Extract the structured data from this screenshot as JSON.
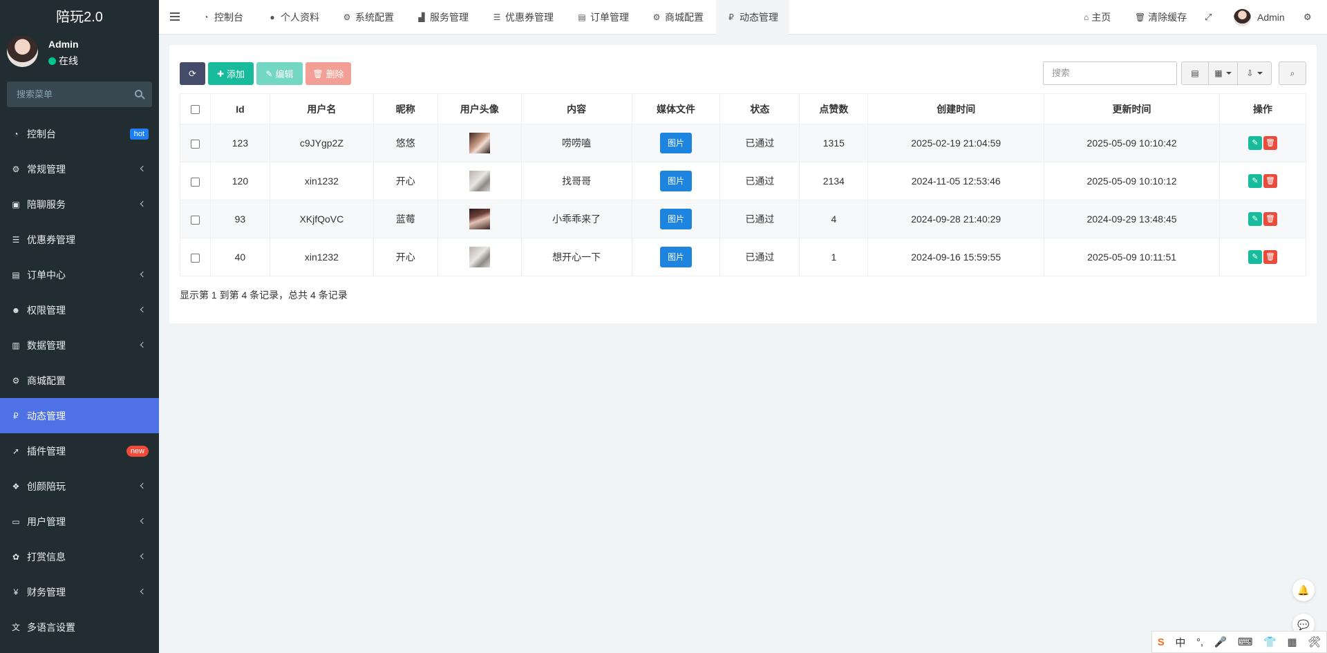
{
  "app": {
    "title": "陪玩2.0"
  },
  "user": {
    "name": "Admin",
    "status": "在线"
  },
  "sidebar": {
    "search_placeholder": "搜索菜单",
    "items": [
      {
        "label": "控制台",
        "icon": "dashboard-icon",
        "badge": "hot"
      },
      {
        "label": "常规管理",
        "icon": "cogs-icon",
        "has_children": true
      },
      {
        "label": "陪聊服务",
        "icon": "box-icon",
        "has_children": true
      },
      {
        "label": "优惠券管理",
        "icon": "list-icon"
      },
      {
        "label": "订单中心",
        "icon": "file-icon",
        "has_children": true
      },
      {
        "label": "权限管理",
        "icon": "group-icon",
        "has_children": true
      },
      {
        "label": "数据管理",
        "icon": "bar-chart-icon",
        "has_children": true
      },
      {
        "label": "商城配置",
        "icon": "cogs-icon"
      },
      {
        "label": "动态管理",
        "icon": "ruble-icon",
        "active": true
      },
      {
        "label": "插件管理",
        "icon": "rocket-icon",
        "badge": "new"
      },
      {
        "label": "创颜陪玩",
        "icon": "dropbox-icon",
        "has_children": true
      },
      {
        "label": "用户管理",
        "icon": "id-card-icon",
        "has_children": true
      },
      {
        "label": "打赏信息",
        "icon": "gift-icon",
        "has_children": true
      },
      {
        "label": "财务管理",
        "icon": "yen-icon",
        "has_children": true
      },
      {
        "label": "多语言设置",
        "icon": "language-icon"
      }
    ]
  },
  "navbar": {
    "tabs": [
      {
        "label": "控制台",
        "icon": "dashboard-icon"
      },
      {
        "label": "个人资料",
        "icon": "user-icon"
      },
      {
        "label": "系统配置",
        "icon": "gear-icon"
      },
      {
        "label": "服务管理",
        "icon": "shopping-bag-icon"
      },
      {
        "label": "优惠券管理",
        "icon": "list-icon"
      },
      {
        "label": "订单管理",
        "icon": "file-icon"
      },
      {
        "label": "商城配置",
        "icon": "cogs-icon"
      },
      {
        "label": "动态管理",
        "icon": "ruble-icon",
        "active": true
      }
    ],
    "home": "主页",
    "clear_cache": "清除缓存",
    "admin": "Admin"
  },
  "toolbar": {
    "add": "添加",
    "edit": "编辑",
    "delete": "删除",
    "search_placeholder": "搜索"
  },
  "table": {
    "columns": [
      "Id",
      "用户名",
      "昵称",
      "用户头像",
      "内容",
      "媒体文件",
      "状态",
      "点赞数",
      "创建时间",
      "更新时间",
      "操作"
    ],
    "media_label": "图片",
    "rows": [
      {
        "id": "123",
        "username": "c9JYgp2Z",
        "nickname": "悠悠",
        "content": "唠唠嗑",
        "status": "已通过",
        "likes": "1315",
        "created": "2025-02-19 21:04:59",
        "updated": "2025-05-09 10:10:42"
      },
      {
        "id": "120",
        "username": "xin1232",
        "nickname": "开心",
        "content": "找哥哥",
        "status": "已通过",
        "likes": "2134",
        "created": "2024-11-05 12:53:46",
        "updated": "2025-05-09 10:10:12"
      },
      {
        "id": "93",
        "username": "XKjfQoVC",
        "nickname": "蓝莓",
        "content": "小乖乖来了",
        "status": "已通过",
        "likes": "4",
        "created": "2024-09-28 21:40:29",
        "updated": "2024-09-29 13:48:45"
      },
      {
        "id": "40",
        "username": "xin1232",
        "nickname": "开心",
        "content": "想开心一下",
        "status": "已通过",
        "likes": "1",
        "created": "2024-09-16 15:59:55",
        "updated": "2025-05-09 10:11:51"
      }
    ]
  },
  "pager": {
    "info": "显示第 1 到第 4 条记录，总共 4 条记录"
  },
  "ime": {
    "items": [
      "S",
      "中",
      "°,",
      "🎤",
      "⌨",
      "👕",
      "▦",
      "🛠"
    ]
  }
}
